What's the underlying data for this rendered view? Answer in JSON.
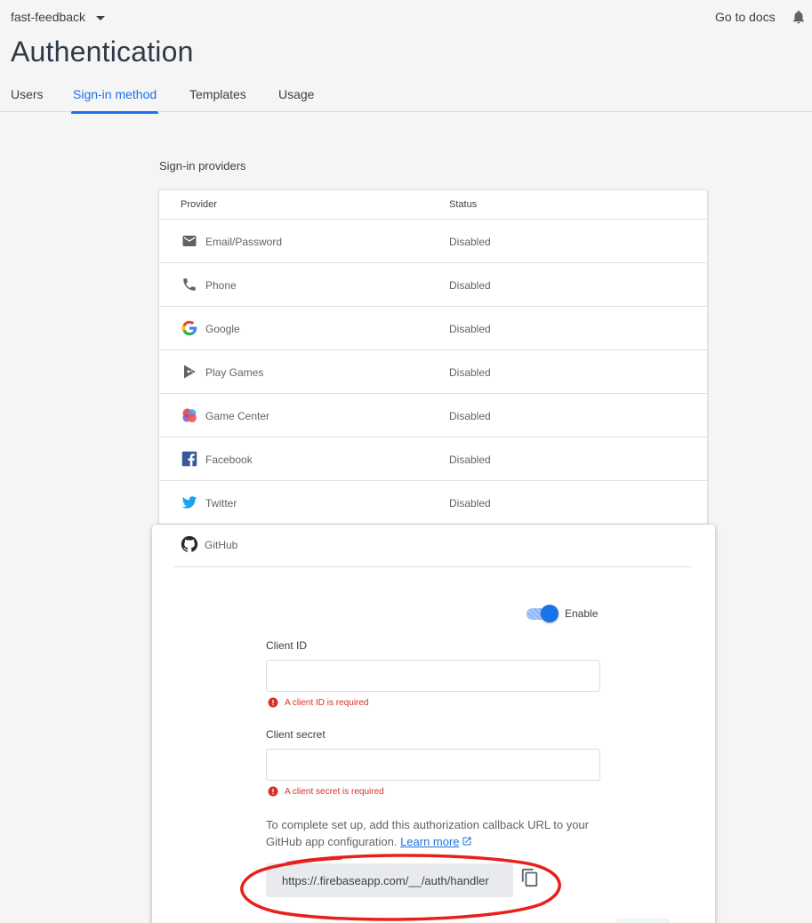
{
  "header": {
    "project_name": "fast-feedback",
    "docs_link": "Go to docs",
    "page_title": "Authentication"
  },
  "tabs": [
    {
      "label": "Users",
      "active": false
    },
    {
      "label": "Sign-in method",
      "active": true
    },
    {
      "label": "Templates",
      "active": false
    },
    {
      "label": "Usage",
      "active": false
    }
  ],
  "providers_section": {
    "heading": "Sign-in providers",
    "columns": {
      "provider": "Provider",
      "status": "Status"
    },
    "rows": [
      {
        "name": "Email/Password",
        "status": "Disabled",
        "icon": "mail-icon"
      },
      {
        "name": "Phone",
        "status": "Disabled",
        "icon": "phone-icon"
      },
      {
        "name": "Google",
        "status": "Disabled",
        "icon": "google-icon"
      },
      {
        "name": "Play Games",
        "status": "Disabled",
        "icon": "play-games-icon"
      },
      {
        "name": "Game Center",
        "status": "Disabled",
        "icon": "game-center-icon"
      },
      {
        "name": "Facebook",
        "status": "Disabled",
        "icon": "facebook-icon"
      },
      {
        "name": "Twitter",
        "status": "Disabled",
        "icon": "twitter-icon"
      }
    ]
  },
  "github": {
    "name": "GitHub",
    "icon": "github-icon",
    "enable_label": "Enable",
    "enabled": true,
    "client_id": {
      "label": "Client ID",
      "value": "",
      "error": "A client ID is required"
    },
    "client_secret": {
      "label": "Client secret",
      "value": "",
      "error": "A client secret is required"
    },
    "note_text": "To complete set up, add this authorization callback URL to your GitHub app configuration.",
    "learn_more": "Learn more",
    "callback_url": "https://.firebaseapp.com/__/auth/handler"
  },
  "colors": {
    "accent": "#1a73e8",
    "error": "#d93025",
    "annotation": "#e8201c"
  }
}
